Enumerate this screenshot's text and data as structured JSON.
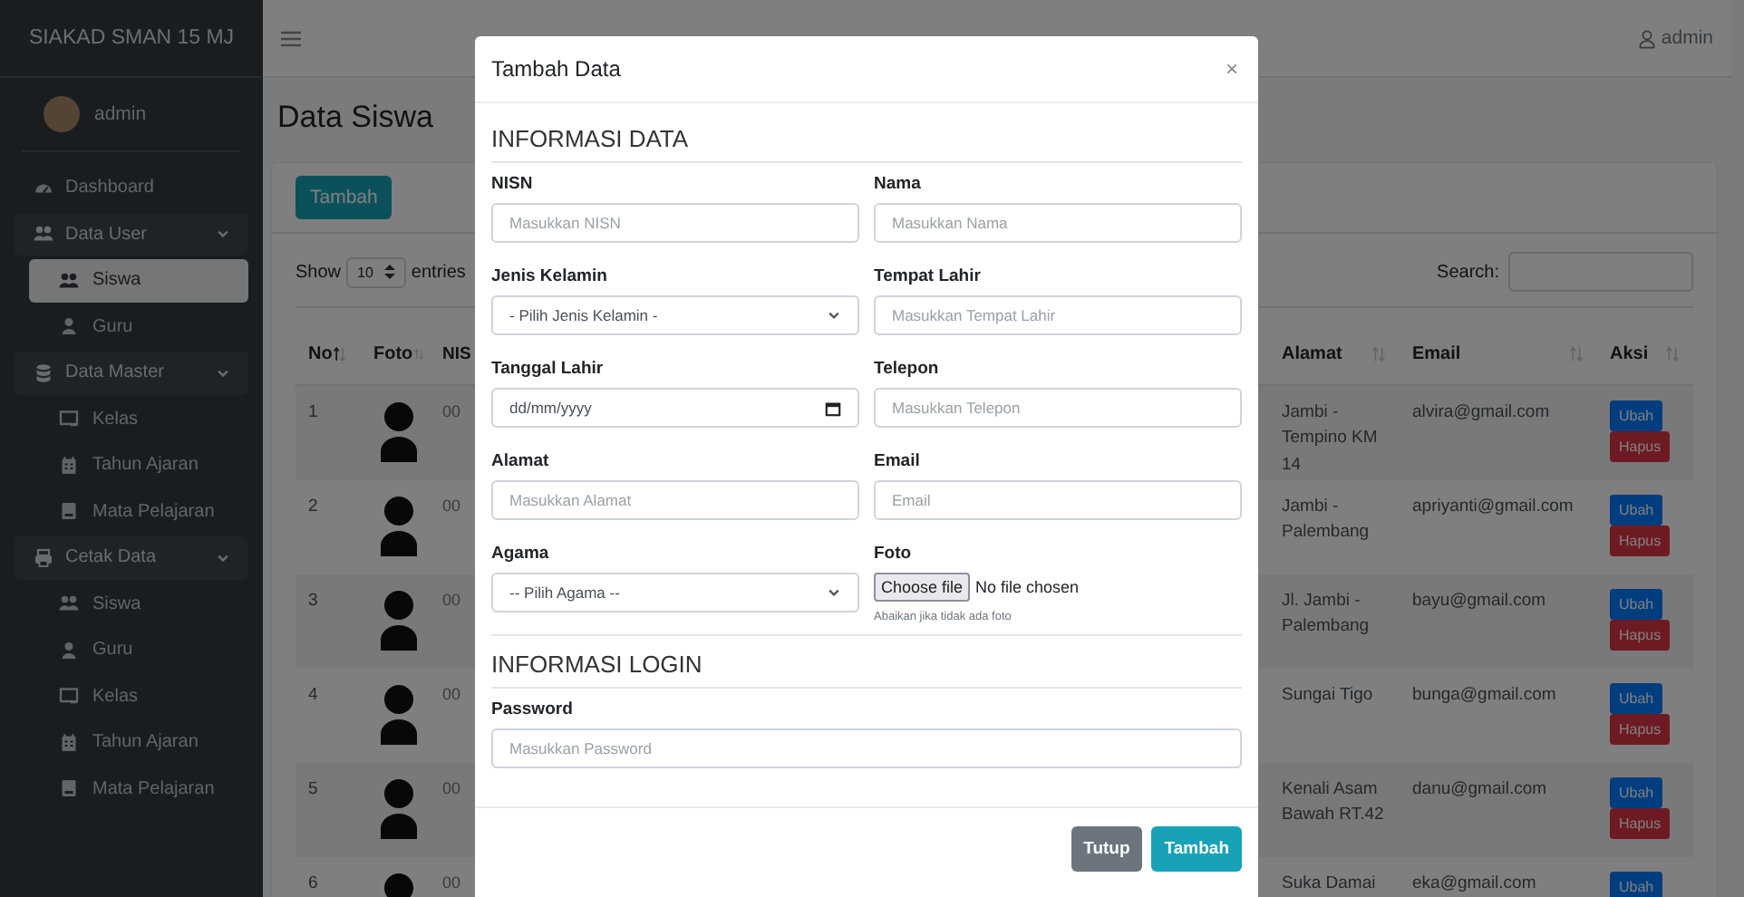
{
  "sidebar": {
    "brand": "SIAKAD SMAN 15 MJ",
    "user": "admin",
    "menu": [
      {
        "label": "Dashboard",
        "kind": "link"
      },
      {
        "label": "Data User",
        "kind": "group",
        "expanded": true,
        "children": [
          {
            "label": "Siswa",
            "selected": true
          },
          {
            "label": "Guru",
            "selected": false
          }
        ]
      },
      {
        "label": "Data Master",
        "kind": "group",
        "expanded": true,
        "children": [
          {
            "label": "Kelas",
            "selected": false
          },
          {
            "label": "Tahun Ajaran",
            "selected": false
          },
          {
            "label": "Mata Pelajaran",
            "selected": false
          }
        ]
      },
      {
        "label": "Cetak Data",
        "kind": "group",
        "expanded": true,
        "children": [
          {
            "label": "Siswa",
            "selected": false
          },
          {
            "label": "Guru",
            "selected": false
          },
          {
            "label": "Kelas",
            "selected": false
          },
          {
            "label": "Tahun Ajaran",
            "selected": false
          },
          {
            "label": "Mata Pelajaran",
            "selected": false
          }
        ]
      }
    ]
  },
  "navbar": {
    "user": "admin"
  },
  "page_title": "Data Siswa",
  "card": {
    "add_button": "Tambah",
    "length": {
      "show": "Show",
      "value": "10",
      "entries": "entries"
    },
    "search_label": "Search:",
    "table": {
      "columns": [
        {
          "label": "No",
          "sorted": true
        },
        {
          "label": "Foto",
          "sorted": false
        },
        {
          "label": "NIS"
        },
        {
          "label": "Alamat",
          "sorted": false
        },
        {
          "label": "Email",
          "sorted": false
        },
        {
          "label": "Aksi",
          "sorted": false
        }
      ],
      "rows": [
        {
          "no": "1",
          "nis": "00",
          "alamat": "Jambi - Tempino KM 14",
          "email": "alvira@gmail.com",
          "actions": [
            "Ubah",
            "Hapus"
          ]
        },
        {
          "no": "2",
          "nis": "00",
          "alamat": "Jambi - Palembang",
          "email": "apriyanti@gmail.com",
          "actions": [
            "Ubah",
            "Hapus"
          ]
        },
        {
          "no": "3",
          "nis": "00",
          "alamat": "Jl. Jambi - Palembang",
          "email": "bayu@gmail.com",
          "actions": [
            "Ubah",
            "Hapus"
          ]
        },
        {
          "no": "4",
          "nis": "00",
          "alamat": "Sungai Tigo",
          "email": "bunga@gmail.com",
          "actions": [
            "Ubah",
            "Hapus"
          ]
        },
        {
          "no": "5",
          "nis": "00",
          "alamat": "Kenali Asam Bawah RT.42",
          "email": "danu@gmail.com",
          "actions": [
            "Ubah",
            "Hapus"
          ]
        },
        {
          "no": "6",
          "nis": "00",
          "alamat": "Suka Damai",
          "email": "eka@gmail.com",
          "actions": [
            "Ubah"
          ]
        }
      ]
    }
  },
  "modal": {
    "title": "Tambah Data",
    "close": "×",
    "sections": [
      {
        "heading": "INFORMASI DATA",
        "fields": [
          {
            "label": "NISN",
            "kind": "text",
            "placeholder": "Masukkan NISN"
          },
          {
            "label": "Nama",
            "kind": "text",
            "placeholder": "Masukkan Nama"
          },
          {
            "label": "Jenis Kelamin",
            "kind": "select",
            "value": "- Pilih Jenis Kelamin -"
          },
          {
            "label": "Tempat Lahir",
            "kind": "text",
            "placeholder": "Masukkan Tempat Lahir"
          },
          {
            "label": "Tanggal Lahir",
            "kind": "date",
            "placeholder": "dd/mm/yyyy"
          },
          {
            "label": "Telepon",
            "kind": "text",
            "placeholder": "Masukkan Telepon"
          },
          {
            "label": "Alamat",
            "kind": "text",
            "placeholder": "Masukkan Alamat"
          },
          {
            "label": "Email",
            "kind": "text",
            "placeholder": "Email"
          },
          {
            "label": "Agama",
            "kind": "select",
            "value": "-- Pilih Agama --"
          },
          {
            "label": "Foto",
            "kind": "file",
            "button": "Choose file",
            "status": "No file chosen",
            "hint": "Abaikan jika tidak ada foto"
          }
        ]
      },
      {
        "heading": "INFORMASI LOGIN",
        "fields": [
          {
            "label": "Password",
            "kind": "text",
            "placeholder": "Masukkan Password",
            "full_width": true
          }
        ]
      }
    ],
    "buttons": [
      {
        "label": "Tutup",
        "kind": "secondary"
      },
      {
        "label": "Tambah",
        "kind": "primary"
      }
    ]
  }
}
